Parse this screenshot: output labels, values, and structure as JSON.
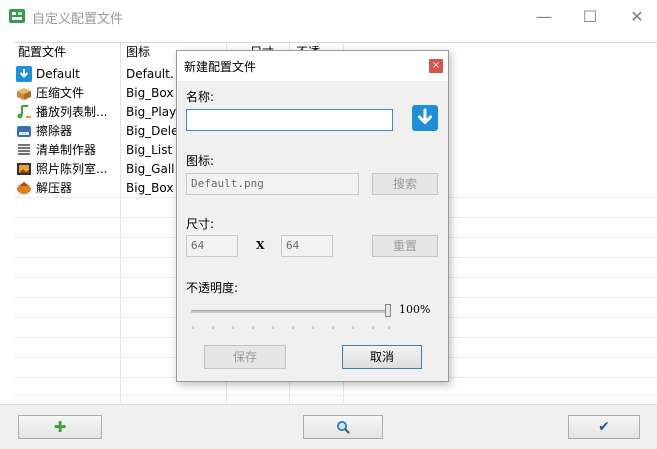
{
  "window": {
    "title": "自定义配置文件",
    "minimize_glyph": "—",
    "maximize_glyph": "☐",
    "close_glyph": "✕"
  },
  "list": {
    "columns": [
      "配置文件",
      "图标",
      "尺寸",
      "不透"
    ],
    "rows": [
      {
        "name": "Default",
        "icon": "Default.",
        "icon_kind": "download-icon"
      },
      {
        "name": "压缩文件",
        "icon": "Big_Box",
        "icon_kind": "box-icon"
      },
      {
        "name": "播放列表制...",
        "icon": "Big_Play",
        "icon_kind": "playlist-icon"
      },
      {
        "name": "擦除器",
        "icon": "Big_Dele",
        "icon_kind": "eraser-icon"
      },
      {
        "name": "清单制作器",
        "icon": "Big_List",
        "icon_kind": "list-icon"
      },
      {
        "name": "照片陈列室...",
        "icon": "Big_Gall",
        "icon_kind": "gallery-icon"
      },
      {
        "name": "解压器",
        "icon": "Big_Box",
        "icon_kind": "extractor-icon"
      }
    ]
  },
  "bottom": {
    "add_glyph": "✚",
    "search_glyph": "🔍",
    "ok_glyph": "✔"
  },
  "dialog": {
    "title": "新建配置文件",
    "close_glyph": "×",
    "name_label": "名称:",
    "name_value": "",
    "icon_label": "图标:",
    "icon_value": "Default.png",
    "browse_button": "搜索",
    "size_label": "尺寸:",
    "width_value": "64",
    "size_x": "X",
    "height_value": "64",
    "reset_button": "重置",
    "opacity_label": "不透明度:",
    "opacity_value": "100%",
    "opacity_level": 1.0,
    "save_button": "保存",
    "cancel_button": "取消"
  },
  "colors": {
    "accent": "#1e8fd6",
    "close_red": "#d9534f",
    "add_green": "#3aa63a"
  }
}
